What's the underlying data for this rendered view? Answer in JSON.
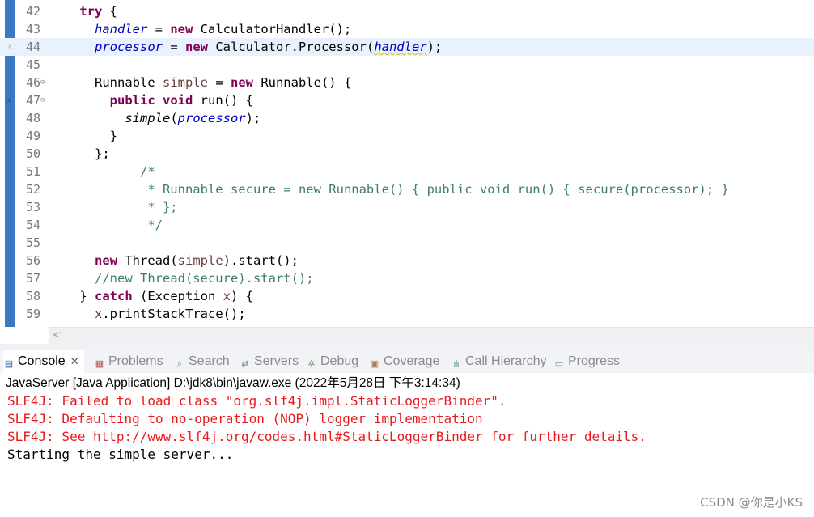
{
  "editor": {
    "lines": [
      {
        "num": "42",
        "fold": "",
        "tokens": [
          {
            "t": "    ",
            "c": ""
          },
          {
            "t": "try",
            "c": "kw"
          },
          {
            "t": " {",
            "c": ""
          }
        ]
      },
      {
        "num": "43",
        "fold": "",
        "tokens": [
          {
            "t": "      ",
            "c": ""
          },
          {
            "t": "handler",
            "c": "fld"
          },
          {
            "t": " = ",
            "c": ""
          },
          {
            "t": "new",
            "c": "kw"
          },
          {
            "t": " CalculatorHandler();",
            "c": ""
          }
        ]
      },
      {
        "num": "44",
        "fold": "",
        "current": true,
        "tokens": [
          {
            "t": "      ",
            "c": ""
          },
          {
            "t": "processor",
            "c": "fld"
          },
          {
            "t": " = ",
            "c": ""
          },
          {
            "t": "new",
            "c": "kw"
          },
          {
            "t": " Calculator.Processor(",
            "c": ""
          },
          {
            "t": "handler",
            "c": "fld"
          },
          {
            "t": ");",
            "c": ""
          }
        ]
      },
      {
        "num": "45",
        "fold": "",
        "tokens": []
      },
      {
        "num": "46",
        "fold": "⊖",
        "tokens": [
          {
            "t": "      Runnable ",
            "c": ""
          },
          {
            "t": "simple",
            "c": "loc"
          },
          {
            "t": " = ",
            "c": ""
          },
          {
            "t": "new",
            "c": "kw"
          },
          {
            "t": " Runnable() {",
            "c": ""
          }
        ]
      },
      {
        "num": "47",
        "fold": "⊖",
        "tokens": [
          {
            "t": "        ",
            "c": ""
          },
          {
            "t": "public",
            "c": "kw"
          },
          {
            "t": " ",
            "c": ""
          },
          {
            "t": "void",
            "c": "kw"
          },
          {
            "t": " run() {",
            "c": ""
          }
        ]
      },
      {
        "num": "48",
        "fold": "",
        "tokens": [
          {
            "t": "          ",
            "c": ""
          },
          {
            "t": "simple",
            "c": "ital"
          },
          {
            "t": "(",
            "c": ""
          },
          {
            "t": "processor",
            "c": "fld"
          },
          {
            "t": ");",
            "c": ""
          }
        ]
      },
      {
        "num": "49",
        "fold": "",
        "tokens": [
          {
            "t": "        }",
            "c": ""
          }
        ]
      },
      {
        "num": "50",
        "fold": "",
        "tokens": [
          {
            "t": "      };",
            "c": ""
          }
        ]
      },
      {
        "num": "51",
        "fold": "",
        "tokens": [
          {
            "t": "            /*",
            "c": "cm"
          }
        ]
      },
      {
        "num": "52",
        "fold": "",
        "tokens": [
          {
            "t": "             * Runnable secure = new Runnable() { public void run() { secure(processor); }",
            "c": "cm"
          }
        ]
      },
      {
        "num": "53",
        "fold": "",
        "tokens": [
          {
            "t": "             * };",
            "c": "cm"
          }
        ]
      },
      {
        "num": "54",
        "fold": "",
        "tokens": [
          {
            "t": "             */",
            "c": "cm"
          }
        ]
      },
      {
        "num": "55",
        "fold": "",
        "tokens": []
      },
      {
        "num": "56",
        "fold": "",
        "tokens": [
          {
            "t": "      ",
            "c": ""
          },
          {
            "t": "new",
            "c": "kw"
          },
          {
            "t": " Thread(",
            "c": ""
          },
          {
            "t": "simple",
            "c": "loc"
          },
          {
            "t": ").start();",
            "c": ""
          }
        ]
      },
      {
        "num": "57",
        "fold": "",
        "tokens": [
          {
            "t": "      //new Thread(secure).start();",
            "c": "cm"
          }
        ]
      },
      {
        "num": "58",
        "fold": "",
        "tokens": [
          {
            "t": "    } ",
            "c": ""
          },
          {
            "t": "catch",
            "c": "kw"
          },
          {
            "t": " (Exception ",
            "c": ""
          },
          {
            "t": "x",
            "c": "loc"
          },
          {
            "t": ") {",
            "c": ""
          }
        ]
      },
      {
        "num": "59",
        "fold": "",
        "tokens": [
          {
            "t": "      ",
            "c": ""
          },
          {
            "t": "x",
            "c": "loc"
          },
          {
            "t": ".printStackTrace();",
            "c": ""
          }
        ]
      }
    ],
    "hscroll_left": "<"
  },
  "tabs": [
    {
      "label": "Console",
      "icon": "console-icon",
      "glyph": "▤",
      "color": "#1f5fa8",
      "active": true,
      "close": "✕"
    },
    {
      "label": "Problems",
      "icon": "problems-icon",
      "glyph": "▦",
      "color": "#b04a4a"
    },
    {
      "label": "Search",
      "icon": "search-icon",
      "glyph": "⌕",
      "color": "#6f8fb0"
    },
    {
      "label": "Servers",
      "icon": "servers-icon",
      "glyph": "⇄",
      "color": "#6a8a6a"
    },
    {
      "label": "Debug",
      "icon": "debug-icon",
      "glyph": "✲",
      "color": "#6a9a6a"
    },
    {
      "label": "Coverage",
      "icon": "coverage-icon",
      "glyph": "▣",
      "color": "#b07a4a"
    },
    {
      "label": "Call Hierarchy",
      "icon": "call-hierarchy-icon",
      "glyph": "⋔",
      "color": "#4a8a6a"
    },
    {
      "label": "Progress",
      "icon": "progress-icon",
      "glyph": "▭",
      "color": "#6aa06a"
    }
  ],
  "console": {
    "title": "JavaServer [Java Application] D:\\jdk8\\bin\\javaw.exe (2022年5月28日 下午3:14:34)",
    "lines": [
      {
        "text": "SLF4J: Failed to load class \"org.slf4j.impl.StaticLoggerBinder\".",
        "kind": "err"
      },
      {
        "text": "SLF4J: Defaulting to no-operation (NOP) logger implementation",
        "kind": "err"
      },
      {
        "text": "SLF4J: See http://www.slf4j.org/codes.html#StaticLoggerBinder for further details.",
        "kind": "err"
      },
      {
        "text": "Starting the simple server...",
        "kind": "out"
      }
    ]
  },
  "watermark": "CSDN @你是小KS",
  "colors": {
    "keyword": "#7f0055",
    "field": "#0000c0",
    "comment": "#3f7f5f",
    "error_text": "#e8191b",
    "current_line": "#e8f2fe"
  }
}
